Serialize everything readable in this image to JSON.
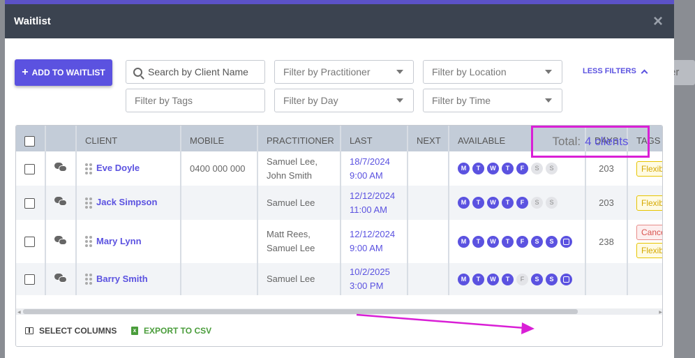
{
  "modal": {
    "title": "Waitlist",
    "close": "×"
  },
  "toolbar": {
    "add_label": "ADD TO WAITLIST",
    "search_placeholder": "Search by Client Name",
    "filter_practitioner": "Filter by Practitioner",
    "filter_location": "Filter by Location",
    "filter_tags": "Filter by Tags",
    "filter_day": "Filter by Day",
    "filter_time": "Filter by Time",
    "less_filters": "LESS FILTERS"
  },
  "background": {
    "right_button_fragment": "er"
  },
  "table": {
    "columns": [
      "CLIENT",
      "MOBILE",
      "PRACTITIONER",
      "LAST",
      "NEXT",
      "AVAILABLE",
      "DAYS",
      "TAGS"
    ],
    "rows": [
      {
        "client": "Eve Doyle",
        "mobile": "0400 000 000",
        "practitioner": [
          "Samuel Lee,",
          "John Smith"
        ],
        "last": [
          "18/7/2024",
          "9:00 AM"
        ],
        "next": "",
        "available": [
          {
            "l": "M",
            "on": true
          },
          {
            "l": "T",
            "on": true
          },
          {
            "l": "W",
            "on": true
          },
          {
            "l": "T",
            "on": true
          },
          {
            "l": "F",
            "on": true
          },
          {
            "l": "S",
            "on": false
          },
          {
            "l": "S",
            "on": false
          }
        ],
        "note": false,
        "days": "203",
        "tags": [
          "Flexible"
        ]
      },
      {
        "client": "Jack Simpson",
        "mobile": "",
        "practitioner": [
          "Samuel Lee"
        ],
        "last": [
          "12/12/2024",
          "11:00 AM"
        ],
        "next": "",
        "available": [
          {
            "l": "M",
            "on": true
          },
          {
            "l": "T",
            "on": true
          },
          {
            "l": "W",
            "on": true
          },
          {
            "l": "T",
            "on": true
          },
          {
            "l": "F",
            "on": true
          },
          {
            "l": "S",
            "on": false
          },
          {
            "l": "S",
            "on": false
          }
        ],
        "note": false,
        "days": "203",
        "tags": [
          "Flexible"
        ]
      },
      {
        "client": "Mary Lynn",
        "mobile": "",
        "practitioner": [
          "Matt Rees,",
          "Samuel Lee"
        ],
        "last": [
          "12/12/2024",
          "9:00 AM"
        ],
        "next": "",
        "available": [
          {
            "l": "M",
            "on": true
          },
          {
            "l": "T",
            "on": true
          },
          {
            "l": "W",
            "on": true
          },
          {
            "l": "T",
            "on": true
          },
          {
            "l": "F",
            "on": true
          },
          {
            "l": "S",
            "on": true
          },
          {
            "l": "S",
            "on": true
          }
        ],
        "note": true,
        "days": "238",
        "tags": [
          "Cancel",
          "Flexible"
        ]
      },
      {
        "client": "Barry Smith",
        "mobile": "",
        "practitioner": [
          "Samuel Lee"
        ],
        "last": [
          "10/2/2025",
          "3:00 PM"
        ],
        "next": "",
        "available": [
          {
            "l": "M",
            "on": true
          },
          {
            "l": "T",
            "on": true
          },
          {
            "l": "W",
            "on": true
          },
          {
            "l": "T",
            "on": true
          },
          {
            "l": "F",
            "on": false
          },
          {
            "l": "S",
            "on": true
          },
          {
            "l": "S",
            "on": true
          }
        ],
        "note": true,
        "days": "",
        "tags": []
      }
    ]
  },
  "footer": {
    "select_columns": "SELECT COLUMNS",
    "export_csv": "EXPORT TO CSV",
    "total_label": "Total:",
    "total_count": "4 clients"
  },
  "colors": {
    "accent": "#5b52e0",
    "highlight": "#d91fd6",
    "header_bg": "#3b4350",
    "export_green": "#4a9d3b"
  }
}
